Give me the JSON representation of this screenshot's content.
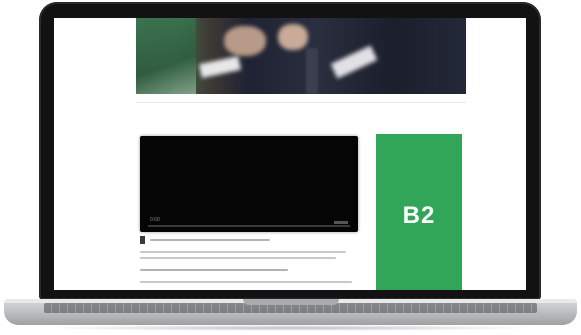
{
  "device": {
    "type": "laptop"
  },
  "page": {
    "hero_image": {
      "alt": ""
    },
    "video": {
      "time_label": "0:00"
    },
    "ad": {
      "label": "B2",
      "color": "#31a558"
    }
  },
  "colors": {
    "bezel": "#121212",
    "screen_bg": "#ffffff",
    "ad_green": "#31a558",
    "chassis": "#bfc1c4"
  }
}
